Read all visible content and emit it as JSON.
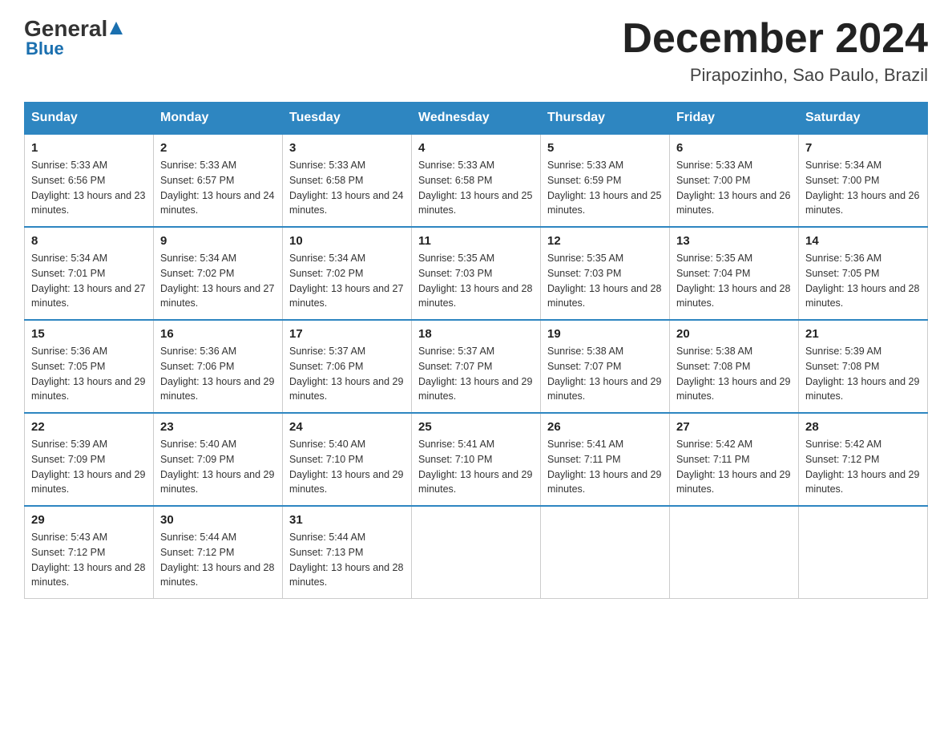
{
  "logo": {
    "general": "General",
    "blue": "Blue"
  },
  "title": "December 2024",
  "location": "Pirapozinho, Sao Paulo, Brazil",
  "headers": [
    "Sunday",
    "Monday",
    "Tuesday",
    "Wednesday",
    "Thursday",
    "Friday",
    "Saturday"
  ],
  "weeks": [
    [
      {
        "day": "1",
        "sunrise": "5:33 AM",
        "sunset": "6:56 PM",
        "daylight": "13 hours and 23 minutes."
      },
      {
        "day": "2",
        "sunrise": "5:33 AM",
        "sunset": "6:57 PM",
        "daylight": "13 hours and 24 minutes."
      },
      {
        "day": "3",
        "sunrise": "5:33 AM",
        "sunset": "6:58 PM",
        "daylight": "13 hours and 24 minutes."
      },
      {
        "day": "4",
        "sunrise": "5:33 AM",
        "sunset": "6:58 PM",
        "daylight": "13 hours and 25 minutes."
      },
      {
        "day": "5",
        "sunrise": "5:33 AM",
        "sunset": "6:59 PM",
        "daylight": "13 hours and 25 minutes."
      },
      {
        "day": "6",
        "sunrise": "5:33 AM",
        "sunset": "7:00 PM",
        "daylight": "13 hours and 26 minutes."
      },
      {
        "day": "7",
        "sunrise": "5:34 AM",
        "sunset": "7:00 PM",
        "daylight": "13 hours and 26 minutes."
      }
    ],
    [
      {
        "day": "8",
        "sunrise": "5:34 AM",
        "sunset": "7:01 PM",
        "daylight": "13 hours and 27 minutes."
      },
      {
        "day": "9",
        "sunrise": "5:34 AM",
        "sunset": "7:02 PM",
        "daylight": "13 hours and 27 minutes."
      },
      {
        "day": "10",
        "sunrise": "5:34 AM",
        "sunset": "7:02 PM",
        "daylight": "13 hours and 27 minutes."
      },
      {
        "day": "11",
        "sunrise": "5:35 AM",
        "sunset": "7:03 PM",
        "daylight": "13 hours and 28 minutes."
      },
      {
        "day": "12",
        "sunrise": "5:35 AM",
        "sunset": "7:03 PM",
        "daylight": "13 hours and 28 minutes."
      },
      {
        "day": "13",
        "sunrise": "5:35 AM",
        "sunset": "7:04 PM",
        "daylight": "13 hours and 28 minutes."
      },
      {
        "day": "14",
        "sunrise": "5:36 AM",
        "sunset": "7:05 PM",
        "daylight": "13 hours and 28 minutes."
      }
    ],
    [
      {
        "day": "15",
        "sunrise": "5:36 AM",
        "sunset": "7:05 PM",
        "daylight": "13 hours and 29 minutes."
      },
      {
        "day": "16",
        "sunrise": "5:36 AM",
        "sunset": "7:06 PM",
        "daylight": "13 hours and 29 minutes."
      },
      {
        "day": "17",
        "sunrise": "5:37 AM",
        "sunset": "7:06 PM",
        "daylight": "13 hours and 29 minutes."
      },
      {
        "day": "18",
        "sunrise": "5:37 AM",
        "sunset": "7:07 PM",
        "daylight": "13 hours and 29 minutes."
      },
      {
        "day": "19",
        "sunrise": "5:38 AM",
        "sunset": "7:07 PM",
        "daylight": "13 hours and 29 minutes."
      },
      {
        "day": "20",
        "sunrise": "5:38 AM",
        "sunset": "7:08 PM",
        "daylight": "13 hours and 29 minutes."
      },
      {
        "day": "21",
        "sunrise": "5:39 AM",
        "sunset": "7:08 PM",
        "daylight": "13 hours and 29 minutes."
      }
    ],
    [
      {
        "day": "22",
        "sunrise": "5:39 AM",
        "sunset": "7:09 PM",
        "daylight": "13 hours and 29 minutes."
      },
      {
        "day": "23",
        "sunrise": "5:40 AM",
        "sunset": "7:09 PM",
        "daylight": "13 hours and 29 minutes."
      },
      {
        "day": "24",
        "sunrise": "5:40 AM",
        "sunset": "7:10 PM",
        "daylight": "13 hours and 29 minutes."
      },
      {
        "day": "25",
        "sunrise": "5:41 AM",
        "sunset": "7:10 PM",
        "daylight": "13 hours and 29 minutes."
      },
      {
        "day": "26",
        "sunrise": "5:41 AM",
        "sunset": "7:11 PM",
        "daylight": "13 hours and 29 minutes."
      },
      {
        "day": "27",
        "sunrise": "5:42 AM",
        "sunset": "7:11 PM",
        "daylight": "13 hours and 29 minutes."
      },
      {
        "day": "28",
        "sunrise": "5:42 AM",
        "sunset": "7:12 PM",
        "daylight": "13 hours and 29 minutes."
      }
    ],
    [
      {
        "day": "29",
        "sunrise": "5:43 AM",
        "sunset": "7:12 PM",
        "daylight": "13 hours and 28 minutes."
      },
      {
        "day": "30",
        "sunrise": "5:44 AM",
        "sunset": "7:12 PM",
        "daylight": "13 hours and 28 minutes."
      },
      {
        "day": "31",
        "sunrise": "5:44 AM",
        "sunset": "7:13 PM",
        "daylight": "13 hours and 28 minutes."
      },
      null,
      null,
      null,
      null
    ]
  ]
}
